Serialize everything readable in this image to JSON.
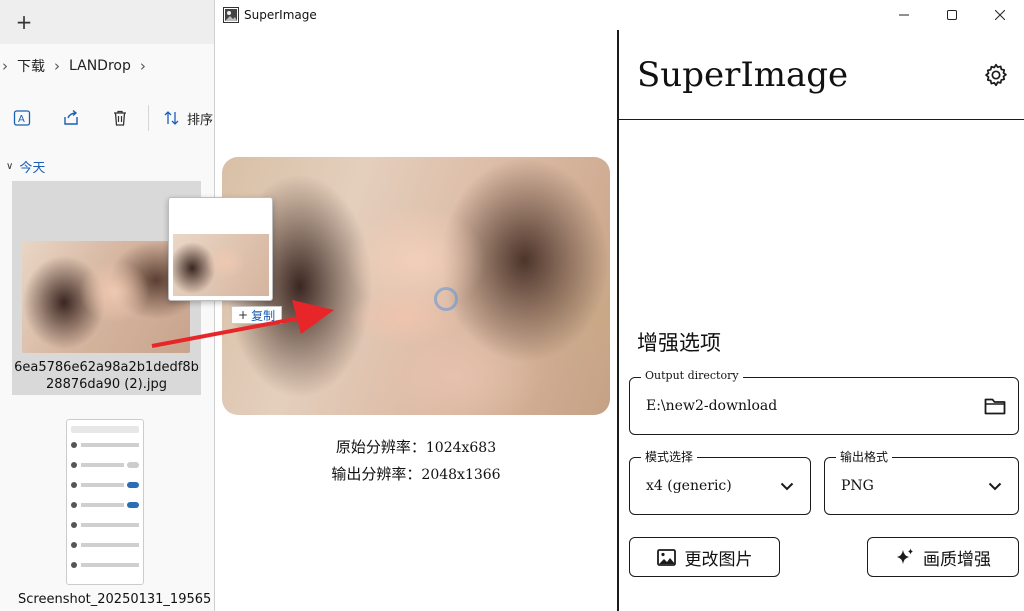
{
  "explorer": {
    "new_tab": "+",
    "breadcrumb": [
      "下载",
      "LANDrop"
    ],
    "sort_label": "排序",
    "group_label": "今天",
    "files": [
      {
        "name": "6ea5786e62a98a2b1dedf8b28876da90 (2).jpg"
      },
      {
        "name": "Screenshot_20250131_19565"
      }
    ],
    "copy_badge": "复制",
    "copy_plus": "+"
  },
  "app": {
    "window_title": "SuperImage",
    "title": "SuperImage",
    "original_resolution_label": "原始分辨率：",
    "original_resolution_value": "1024x683",
    "output_resolution_label": "输出分辨率：",
    "output_resolution_value": "2048x1366",
    "section_title": "增强选项",
    "output_directory": {
      "label": "Output directory",
      "value": "E:\\new2-download"
    },
    "mode_select": {
      "label": "模式选择",
      "value": "x4 (generic)"
    },
    "output_format": {
      "label": "输出格式",
      "value": "PNG"
    },
    "change_image_button": "更改图片",
    "enhance_button": "画质增强"
  },
  "colors": {
    "accent_arrow": "#e8262a",
    "link_blue": "#1a5fb4",
    "border": "#1b1b1b"
  },
  "icons": [
    "gear-icon",
    "folder-icon",
    "chevron-down-icon",
    "image-icon",
    "sparkle-icon",
    "minimize-icon",
    "maximize-icon",
    "close-icon"
  ]
}
